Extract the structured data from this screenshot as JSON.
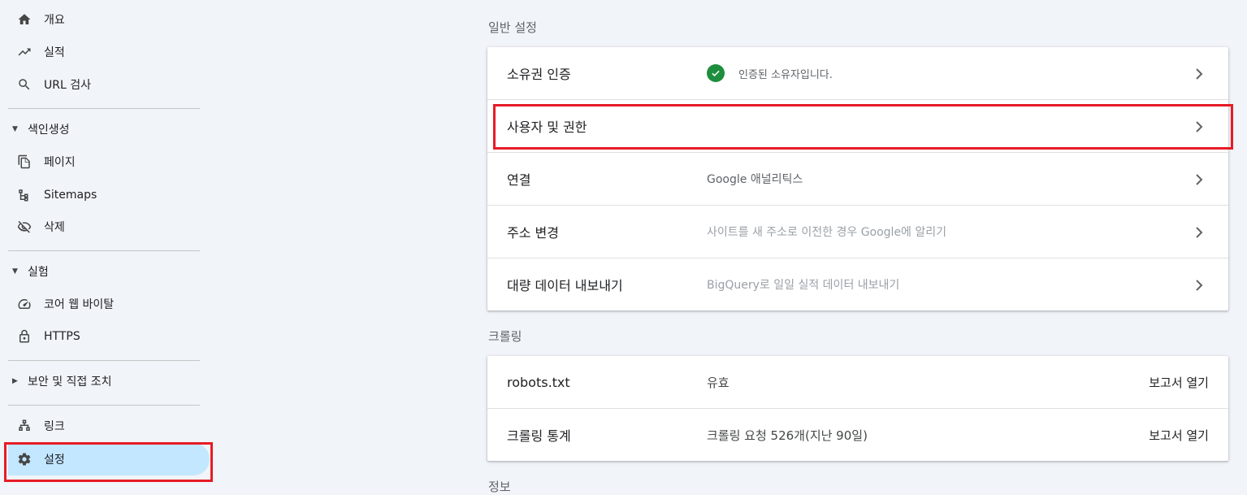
{
  "sidebar": {
    "items": [
      {
        "label": "개요",
        "icon": "home-icon"
      },
      {
        "label": "실적",
        "icon": "trending-up-icon"
      },
      {
        "label": "URL 검사",
        "icon": "search-icon"
      }
    ],
    "index_section": {
      "label": "색인생성",
      "expanded": true,
      "items": [
        {
          "label": "페이지",
          "icon": "pages-icon"
        },
        {
          "label": "Sitemaps",
          "icon": "sitemap-icon"
        },
        {
          "label": "삭제",
          "icon": "eye-off-icon"
        }
      ]
    },
    "experience_section": {
      "label": "실험",
      "expanded": true,
      "items": [
        {
          "label": "코어 웹 바이탈",
          "icon": "speedometer-icon"
        },
        {
          "label": "HTTPS",
          "icon": "lock-icon"
        }
      ]
    },
    "security_section": {
      "label": "보안 및 직접 조치",
      "expanded": false
    },
    "bottom_items": [
      {
        "label": "링크",
        "icon": "links-icon"
      },
      {
        "label": "설정",
        "icon": "gear-icon",
        "active": true
      }
    ]
  },
  "main": {
    "general": {
      "title": "일반 설정",
      "rows": [
        {
          "label": "소유권 인증",
          "value": "인증된 소유자입니다."
        },
        {
          "label": "사용자 및 권한",
          "value": ""
        },
        {
          "label": "연결",
          "value": "Google 애널리틱스"
        },
        {
          "label": "주소 변경",
          "value": "사이트를 새 주소로 이전한 경우 Google에 알리기"
        },
        {
          "label": "대량 데이터 내보내기",
          "value": "BigQuery로 일일 실적 데이터 내보내기"
        }
      ]
    },
    "crawl": {
      "title": "크롤링",
      "rows": [
        {
          "label": "robots.txt",
          "value": "유효",
          "action": "보고서 열기"
        },
        {
          "label": "크롤링 통계",
          "value": "크롤링 요청 526개(지난 90일)",
          "action": "보고서 열기"
        }
      ]
    },
    "next_section_title": "정보"
  },
  "colors": {
    "accent_active": "#c2e7ff",
    "highlight": "#e61c25",
    "success": "#1e8e3e"
  }
}
